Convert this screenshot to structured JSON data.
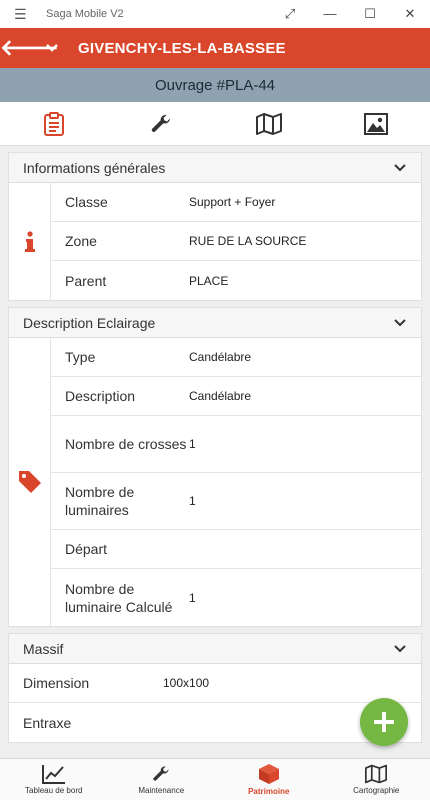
{
  "window": {
    "title": "Saga Mobile V2",
    "controls": [
      "⤢",
      "—",
      "☐",
      "✕"
    ]
  },
  "appbar": {
    "back_icon": "arrow-left-icon",
    "dropdown_icon": "chevron-down-icon",
    "city": "GIVENCHY-LES-LA-BASSEE",
    "color": "#d9462b"
  },
  "subheader": {
    "title": "Ouvrage #PLA-44"
  },
  "tabs": [
    {
      "name": "clipboard-icon",
      "active": true
    },
    {
      "name": "wrench-icon",
      "active": false
    },
    {
      "name": "map-icon",
      "active": false
    },
    {
      "name": "image-icon",
      "active": false
    }
  ],
  "sections": {
    "general": {
      "title": "Informations générales",
      "icon": "info-icon",
      "rows": [
        {
          "label": "Classe",
          "value": "Support + Foyer"
        },
        {
          "label": "Zone",
          "value": "RUE DE LA SOURCE"
        },
        {
          "label": "Parent",
          "value": "PLACE"
        }
      ]
    },
    "eclairage": {
      "title": "Description Eclairage",
      "icon": "tag-icon",
      "rows": [
        {
          "label": "Type",
          "value": "Candélabre"
        },
        {
          "label": "Description",
          "value": "Candélabre"
        },
        {
          "label": "Nombre de crosses",
          "value": "1"
        },
        {
          "label": "Nombre de luminaires",
          "value": "1"
        },
        {
          "label": "Départ",
          "value": ""
        },
        {
          "label": "Nombre de luminaire Calculé",
          "value": "1"
        }
      ]
    },
    "massif": {
      "title": "Massif",
      "rows": [
        {
          "label": "Dimension",
          "value": "100x100"
        },
        {
          "label": "Entraxe",
          "value": ""
        }
      ]
    }
  },
  "fab": {
    "icon": "plus-icon",
    "color": "#74b843"
  },
  "bottom_nav": [
    {
      "label": "Tableau de bord",
      "icon": "chart-line-icon",
      "active": false
    },
    {
      "label": "Maintenance",
      "icon": "wrench-icon",
      "active": false
    },
    {
      "label": "Patrimoine",
      "icon": "cube-icon",
      "active": true
    },
    {
      "label": "Cartographie",
      "icon": "map-icon",
      "active": false
    }
  ]
}
